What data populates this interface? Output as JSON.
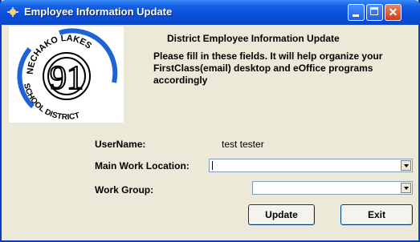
{
  "window": {
    "title": "Employee Information Update"
  },
  "logo": {
    "top_text": "NECHAKO LAKES",
    "bottom_text": "SCHOOL DISTRICT",
    "number": "91"
  },
  "header": {
    "title": "District Employee Information Update",
    "description": "Please fill in these fields. It will help organize your FirstClass(email) desktop and eOffice programs accordingly"
  },
  "form": {
    "username_label": "UserName:",
    "username_value": "test tester",
    "location_label": "Main Work Location:",
    "location_value": "",
    "group_label": "Work Group:",
    "group_value": ""
  },
  "buttons": {
    "update": "Update",
    "exit": "Exit"
  },
  "colors": {
    "titlebar": "#0a4fd8",
    "window_bg": "#ece9d8",
    "logo_blue": "#1e63d6"
  }
}
